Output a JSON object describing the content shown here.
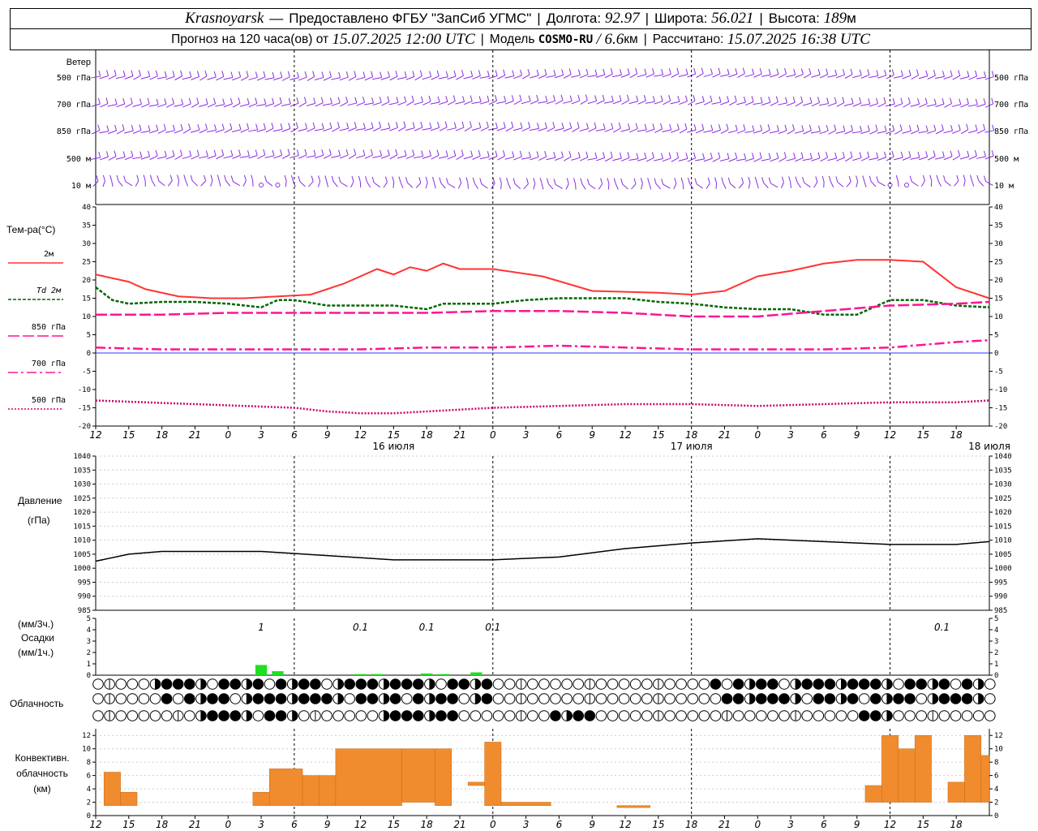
{
  "header": {
    "station": "Krasnoyarsk",
    "dash": "—",
    "provider": "Предоставлено ФГБУ \"ЗапСиб УГМС\"",
    "lon_label": "Долгота:",
    "lon": "92.97",
    "lat_label": "Широта:",
    "lat": "56.021",
    "alt_label": "Высота:",
    "alt": "189",
    "alt_unit": "м",
    "forecast_label": "Прогноз на 120 часа(ов) от",
    "forecast_start": "15.07.2025 12:00 UTC",
    "model_label": "Модель",
    "model": "COSMO-RU",
    "model_res": "/ 6.6",
    "model_res_unit": "км",
    "calc_label": "Рассчитано:",
    "calc_time": "15.07.2025 16:38 UTC"
  },
  "chart_data": [
    {
      "type": "wind_barbs",
      "title": "Ветер",
      "levels": [
        "500 гПа",
        "700 гПа",
        "850 гПа",
        "500 м",
        "10 м"
      ],
      "time_hours_from_start": [
        0,
        54
      ],
      "note_calm_marks_hours": [
        10,
        11,
        48,
        49
      ]
    },
    {
      "type": "line",
      "title": "Тем-ра(°C)",
      "ylim": [
        -20,
        40
      ],
      "yticks": [
        40,
        35,
        30,
        25,
        20,
        15,
        10,
        5,
        0,
        -5,
        -10,
        -15,
        -20
      ],
      "xtick_labels": [
        "12",
        "15",
        "18",
        "21",
        "0",
        "3",
        "6",
        "9",
        "12",
        "15",
        "18",
        "21",
        "0",
        "3",
        "6",
        "9",
        "12",
        "15",
        "18",
        "21",
        "0",
        "3",
        "6",
        "9",
        "12",
        "15",
        "18"
      ],
      "date_labels": [
        "16 июля",
        "17 июля",
        "18 июля"
      ],
      "series": [
        {
          "name": "2м",
          "color": "#ff3333",
          "style": "solid",
          "x": [
            0,
            2,
            3,
            5,
            7,
            9,
            11,
            13,
            15,
            17,
            18,
            19,
            20,
            21,
            22,
            24,
            27,
            30,
            34,
            36,
            38,
            40,
            42,
            44,
            46,
            48,
            50,
            52,
            54
          ],
          "values": [
            21.5,
            19.5,
            17.5,
            15.5,
            15,
            15,
            15.5,
            16,
            19,
            23,
            21.5,
            23.5,
            22.5,
            24.5,
            23,
            23,
            21,
            17,
            16.5,
            16,
            17,
            21,
            22.5,
            24.5,
            25.5,
            25.5,
            25,
            18,
            15
          ]
        },
        {
          "name": "Td  2м",
          "color": "#006600",
          "style": "dashed",
          "x": [
            0,
            1,
            2,
            4,
            6,
            8,
            10,
            11,
            12,
            14,
            16,
            18,
            20,
            21,
            22,
            24,
            26,
            28,
            30,
            32,
            34,
            36,
            38,
            40,
            42,
            44,
            46,
            48,
            50,
            52,
            54
          ],
          "values": [
            18,
            14.5,
            13.5,
            14,
            14,
            13.5,
            12.5,
            14.5,
            14.5,
            13,
            13,
            13,
            12,
            13.5,
            13.5,
            13.5,
            14.5,
            15,
            15,
            15,
            14,
            13.5,
            12.5,
            12,
            12,
            10.5,
            10.5,
            14.5,
            14.5,
            13,
            12.5
          ]
        },
        {
          "name": "850 гПа",
          "color": "#ff1493",
          "style": "longdash",
          "x": [
            0,
            4,
            8,
            12,
            16,
            20,
            24,
            28,
            32,
            36,
            40,
            44,
            48,
            52,
            54
          ],
          "values": [
            10.5,
            10.5,
            11,
            11,
            11,
            11,
            11.5,
            11.5,
            11,
            10,
            10,
            11.5,
            13,
            13.5,
            14
          ]
        },
        {
          "name": "700 гПа",
          "color": "#ff1493",
          "style": "dashdot",
          "x": [
            0,
            4,
            8,
            12,
            16,
            20,
            24,
            28,
            32,
            36,
            40,
            44,
            48,
            52,
            54
          ],
          "values": [
            1.5,
            1,
            1,
            1,
            1,
            1.5,
            1.5,
            2,
            1.5,
            1,
            1,
            1,
            1.5,
            3,
            3.5
          ]
        },
        {
          "name": "500 гПа",
          "color": "#cc0066",
          "style": "dotted",
          "x": [
            0,
            3,
            6,
            9,
            12,
            14,
            16,
            18,
            20,
            24,
            28,
            32,
            36,
            40,
            44,
            48,
            52,
            54
          ],
          "values": [
            -13,
            -13.5,
            -14,
            -14.5,
            -15,
            -16,
            -16.5,
            -16.5,
            -16,
            -15,
            -14.5,
            -14,
            -14,
            -14.5,
            -14,
            -13.5,
            -13.5,
            -13
          ]
        }
      ]
    },
    {
      "type": "line",
      "title": "Давление",
      "ylabel": "(гПа)",
      "ylim": [
        985,
        1040
      ],
      "yticks": [
        1040,
        1035,
        1030,
        1025,
        1020,
        1015,
        1010,
        1005,
        1000,
        995,
        990,
        985
      ],
      "series": [
        {
          "name": "",
          "color": "#000000",
          "style": "solid",
          "x": [
            0,
            2,
            4,
            8,
            10,
            14,
            18,
            20,
            24,
            28,
            32,
            36,
            40,
            44,
            48,
            52,
            54
          ],
          "values": [
            1002.5,
            1005,
            1006,
            1006,
            1006,
            1004.5,
            1003,
            1003,
            1003,
            1004,
            1007,
            1009,
            1010.5,
            1009.5,
            1008.5,
            1008.5,
            1009.5
          ]
        }
      ]
    },
    {
      "type": "bar",
      "title": "Осадки",
      "ylabel_top": "(мм/3ч.)",
      "ylabel_bottom": "(мм/1ч.)",
      "ylim": [
        0,
        5
      ],
      "yticks": [
        5,
        4,
        3,
        2,
        1,
        0
      ],
      "color": "#22dd22",
      "x": [
        10,
        11,
        16,
        17,
        20,
        21,
        23
      ],
      "values": [
        0.9,
        0.35,
        0.1,
        0.1,
        0.15,
        0.1,
        0.25
      ],
      "annotations": [
        {
          "x_hours": 10,
          "text": "1"
        },
        {
          "x_hours": 16,
          "text": "0.1"
        },
        {
          "x_hours": 20,
          "text": "0.1"
        },
        {
          "x_hours": 24,
          "text": "0.1"
        }
      ]
    },
    {
      "type": "cloud_symbols",
      "title": "Облачность",
      "rows": 3
    },
    {
      "type": "bar",
      "title": "Конвективн. облачность",
      "ylabel": "(км)",
      "ylim": [
        0,
        13
      ],
      "yticks": [
        12,
        10,
        8,
        6,
        4,
        2,
        0
      ],
      "color": "#f08c2e",
      "bars": [
        {
          "x0": 0.5,
          "x1": 1.5,
          "base": 1.5,
          "top": 6.5
        },
        {
          "x0": 1.5,
          "x1": 2.5,
          "base": 1.5,
          "top": 3.5
        },
        {
          "x0": 9.5,
          "x1": 10.5,
          "base": 1.5,
          "top": 3.5
        },
        {
          "x0": 10.5,
          "x1": 12.5,
          "base": 1.5,
          "top": 7
        },
        {
          "x0": 12.5,
          "x1": 13.5,
          "base": 1.5,
          "top": 6
        },
        {
          "x0": 13.5,
          "x1": 14.5,
          "base": 1.5,
          "top": 6
        },
        {
          "x0": 14.5,
          "x1": 18.5,
          "base": 1.5,
          "top": 10
        },
        {
          "x0": 18.5,
          "x1": 20.5,
          "base": 2,
          "top": 10
        },
        {
          "x0": 20.5,
          "x1": 21.5,
          "base": 1.5,
          "top": 10
        },
        {
          "x0": 22.5,
          "x1": 23.5,
          "base": 4.5,
          "top": 5
        },
        {
          "x0": 23.5,
          "x1": 24.5,
          "base": 1.5,
          "top": 11
        },
        {
          "x0": 24.5,
          "x1": 27.5,
          "base": 1.5,
          "top": 2
        },
        {
          "x0": 31.5,
          "x1": 33.5,
          "base": 1.2,
          "top": 1.5
        }
      ]
    }
  ]
}
